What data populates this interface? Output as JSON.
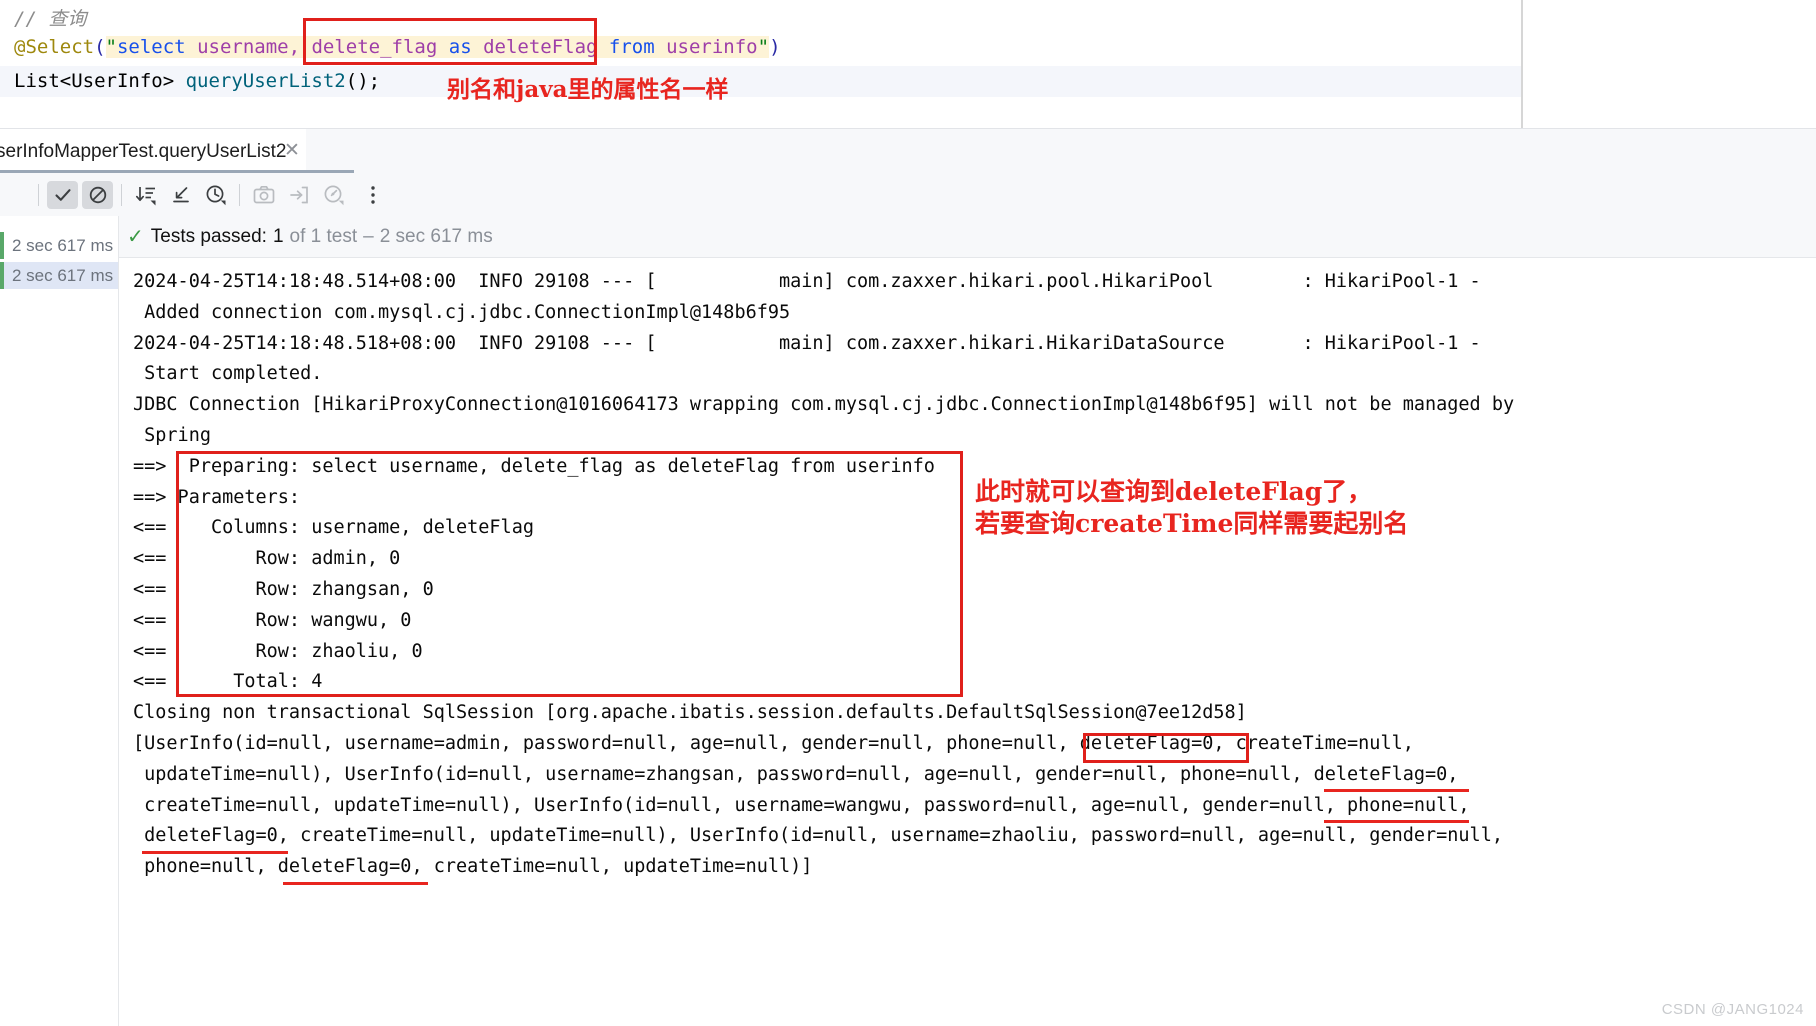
{
  "editor": {
    "comment": "// 查询",
    "select_line": {
      "annotation": "@Select",
      "open_paren": "(",
      "quote_open": "\"",
      "seg_kw1": "select",
      "seg_plain1": " username, ",
      "seg_kw2": "delete_flag",
      "seg_plain2": " as ",
      "seg_plain3": "deleteFlag",
      "seg_kw3": " from ",
      "seg_plain4": "userinfo",
      "quote_close": "\"",
      "close_paren": ")"
    },
    "method_line": {
      "type": "List<UserInfo>",
      "name": " queryUserList2",
      "tail": "();"
    },
    "annotation_alias": "别名和java里的属性名一样"
  },
  "tab": {
    "label": "serInfoMapperTest.queryUserList2",
    "close_icon": "close-icon"
  },
  "toolbar": {
    "buttons": [
      {
        "name": "show-passed-toggle",
        "icon": "check-icon",
        "active": true
      },
      {
        "name": "show-ignored-toggle",
        "icon": "circle-slash-icon",
        "active": true
      },
      {
        "name": "sort-by-duration",
        "icon": "sort-descending-icon",
        "active": false
      },
      {
        "name": "expand-collapse",
        "icon": "collapse-arrow-icon",
        "active": false
      },
      {
        "name": "history",
        "icon": "clock-icon",
        "active": false
      },
      {
        "name": "screenshot",
        "icon": "camera-icon",
        "active": false
      },
      {
        "name": "export-results",
        "icon": "export-icon",
        "active": false
      },
      {
        "name": "profiler",
        "icon": "gauge-icon",
        "active": false
      },
      {
        "name": "more-options",
        "icon": "vertical-dots-icon",
        "active": false
      }
    ]
  },
  "tree": {
    "rows": [
      {
        "time": "2 sec 617 ms",
        "selected": false
      },
      {
        "time": "2 sec 617 ms",
        "selected": true
      }
    ]
  },
  "tests_header": {
    "check_icon": "check-icon",
    "label": "Tests passed:",
    "count": "1",
    "of_text": "of 1 test",
    "separator": "–",
    "duration": "2 sec 617 ms"
  },
  "console": {
    "lines": [
      "2024-04-25T14:18:48.514+08:00  INFO 29108 --- [           main] com.zaxxer.hikari.pool.HikariPool        : HikariPool-1 -",
      " Added connection com.mysql.cj.jdbc.ConnectionImpl@148b6f95",
      "2024-04-25T14:18:48.518+08:00  INFO 29108 --- [           main] com.zaxxer.hikari.HikariDataSource       : HikariPool-1 -",
      " Start completed.",
      "JDBC Connection [HikariProxyConnection@1016064173 wrapping com.mysql.cj.jdbc.ConnectionImpl@148b6f95] will not be managed by",
      " Spring",
      "==>  Preparing: select username, delete_flag as deleteFlag from userinfo",
      "==> Parameters: ",
      "<==    Columns: username, deleteFlag",
      "<==        Row: admin, 0",
      "<==        Row: zhangsan, 0",
      "<==        Row: wangwu, 0",
      "<==        Row: zhaoliu, 0",
      "<==      Total: 4",
      "Closing non transactional SqlSession [org.apache.ibatis.session.defaults.DefaultSqlSession@7ee12d58]",
      "[UserInfo(id=null, username=admin, password=null, age=null, gender=null, phone=null, deleteFlag=0, createTime=null,",
      " updateTime=null), UserInfo(id=null, username=zhangsan, password=null, age=null, gender=null, phone=null, deleteFlag=0,",
      " createTime=null, updateTime=null), UserInfo(id=null, username=wangwu, password=null, age=null, gender=null, phone=null,",
      " deleteFlag=0, createTime=null, updateTime=null), UserInfo(id=null, username=zhaoliu, password=null, age=null, gender=null,",
      " phone=null, deleteFlag=0, createTime=null, updateTime=null)]"
    ],
    "annotation_deleteflag": "此时就可以查询到deleteFlag了，\n若要查询createTime同样需要起别名"
  },
  "watermark": "CSDN @JANG1024",
  "colors": {
    "accent_red": "#e0201b",
    "annotation_red": "#e8251f",
    "pass_green": "#59a869",
    "string_blue": "#1750eb",
    "keyword_purple": "#9e3ea8"
  }
}
